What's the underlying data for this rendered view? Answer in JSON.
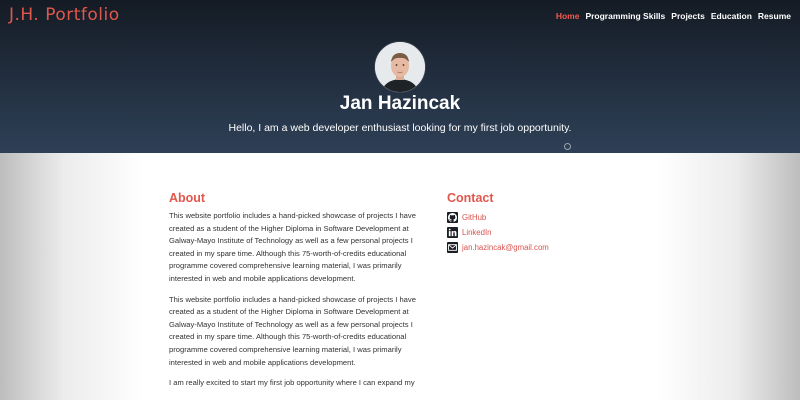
{
  "header": {
    "logo": "J.H. Portfolio",
    "nav": [
      "Home",
      "Programming Skills",
      "Projects",
      "Education",
      "Resume"
    ]
  },
  "hero": {
    "name": "Jan Hazincak",
    "tagline": "Hello, I am a web developer enthusiast looking for my first job opportunity."
  },
  "about": {
    "heading": "About",
    "paragraphs": [
      "This website portfolio includes a hand-picked showcase of projects I have created as a student of the Higher Diploma in Software Development at Galway-Mayo Institute of Technology as well as a few personal projects I created in my spare time. Although this 75-worth-of-credits educational programme covered comprehensive learning material, I was primarily interested in web and mobile applications development.",
      "This website portfolio includes a hand-picked showcase of projects I have created as a student of the Higher Diploma in Software Development at Galway-Mayo Institute of Technology as well as a few personal projects I created in my spare time. Although this 75-worth-of-credits educational programme covered comprehensive learning material, I was primarily interested in web and mobile applications development.",
      "I am really excited to start my first job opportunity where I can expand my"
    ]
  },
  "contact": {
    "heading": "Contact",
    "items": [
      {
        "icon": "github-icon",
        "label": "GitHub"
      },
      {
        "icon": "linkedin-icon",
        "label": "LinkedIn"
      },
      {
        "icon": "mail-icon",
        "label": "jan.hazincak@gmail.com"
      }
    ]
  },
  "colors": {
    "accent": "#e2574c",
    "nav_active": "#f15b4f",
    "hero_top": "#141b24",
    "hero_bottom": "#2e4057"
  }
}
